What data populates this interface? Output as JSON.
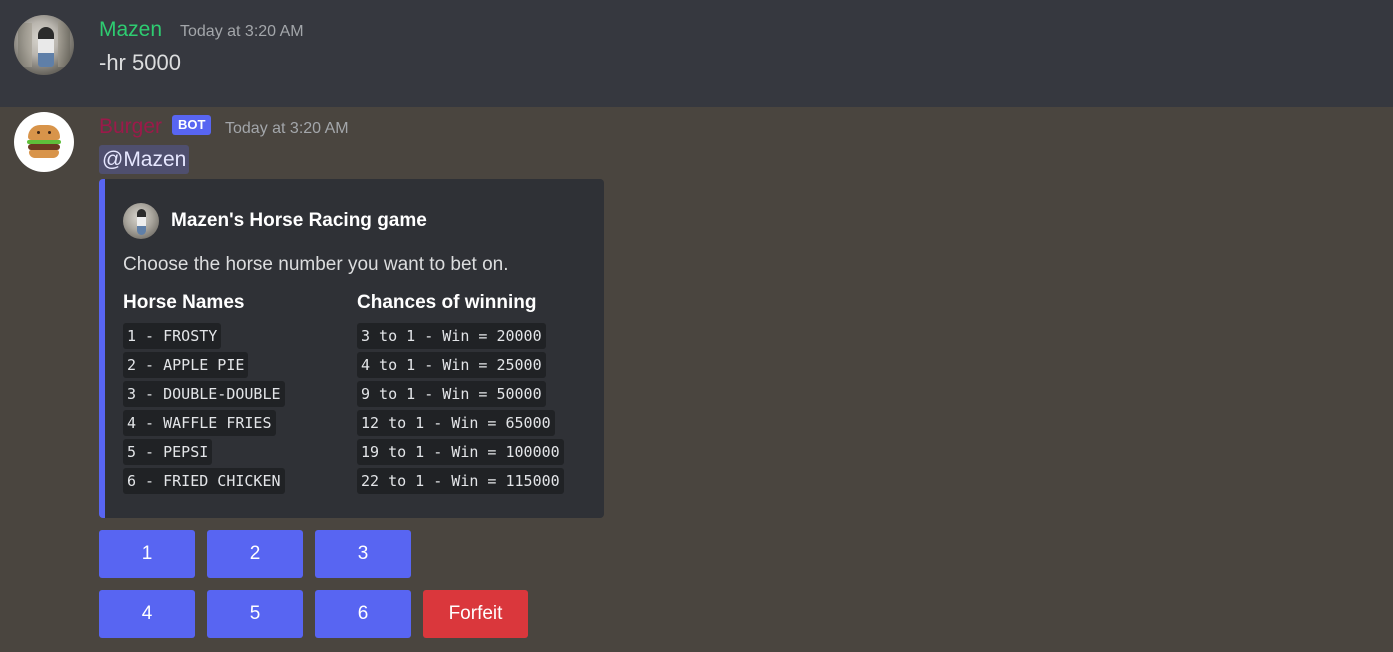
{
  "messages": [
    {
      "username": "Mazen",
      "timestamp": "Today at 3:20 AM",
      "content": "-hr 5000",
      "username_color": "#2ecc71"
    },
    {
      "username": "Burger",
      "badge": "BOT",
      "timestamp": "Today at 3:20 AM",
      "mention": "@Mazen",
      "username_color": "#9b1a4a"
    }
  ],
  "embed": {
    "accent_color": "#5865f2",
    "title": "Mazen's Horse Racing game",
    "description": "Choose the horse number you want to bet on.",
    "fields": [
      {
        "name": "Horse Names",
        "values": [
          "1 - FROSTY",
          "2 - APPLE PIE",
          "3 - DOUBLE-DOUBLE",
          "4 - WAFFLE FRIES",
          "5 - PEPSI",
          "6 - FRIED CHICKEN"
        ]
      },
      {
        "name": "Chances of winning",
        "values": [
          "3 to 1 - Win = 20000",
          "4 to 1 - Win = 25000",
          "9 to 1 - Win = 50000",
          "12 to 1 - Win = 65000",
          "19 to 1 - Win = 100000",
          "22 to 1 - Win = 115000"
        ]
      }
    ]
  },
  "buttons": {
    "row1": [
      "1",
      "2",
      "3"
    ],
    "row2": [
      "4",
      "5",
      "6",
      "Forfeit"
    ]
  },
  "icons": {
    "user_avatar": "user-avatar-photo",
    "bot_avatar": "burger-icon"
  }
}
